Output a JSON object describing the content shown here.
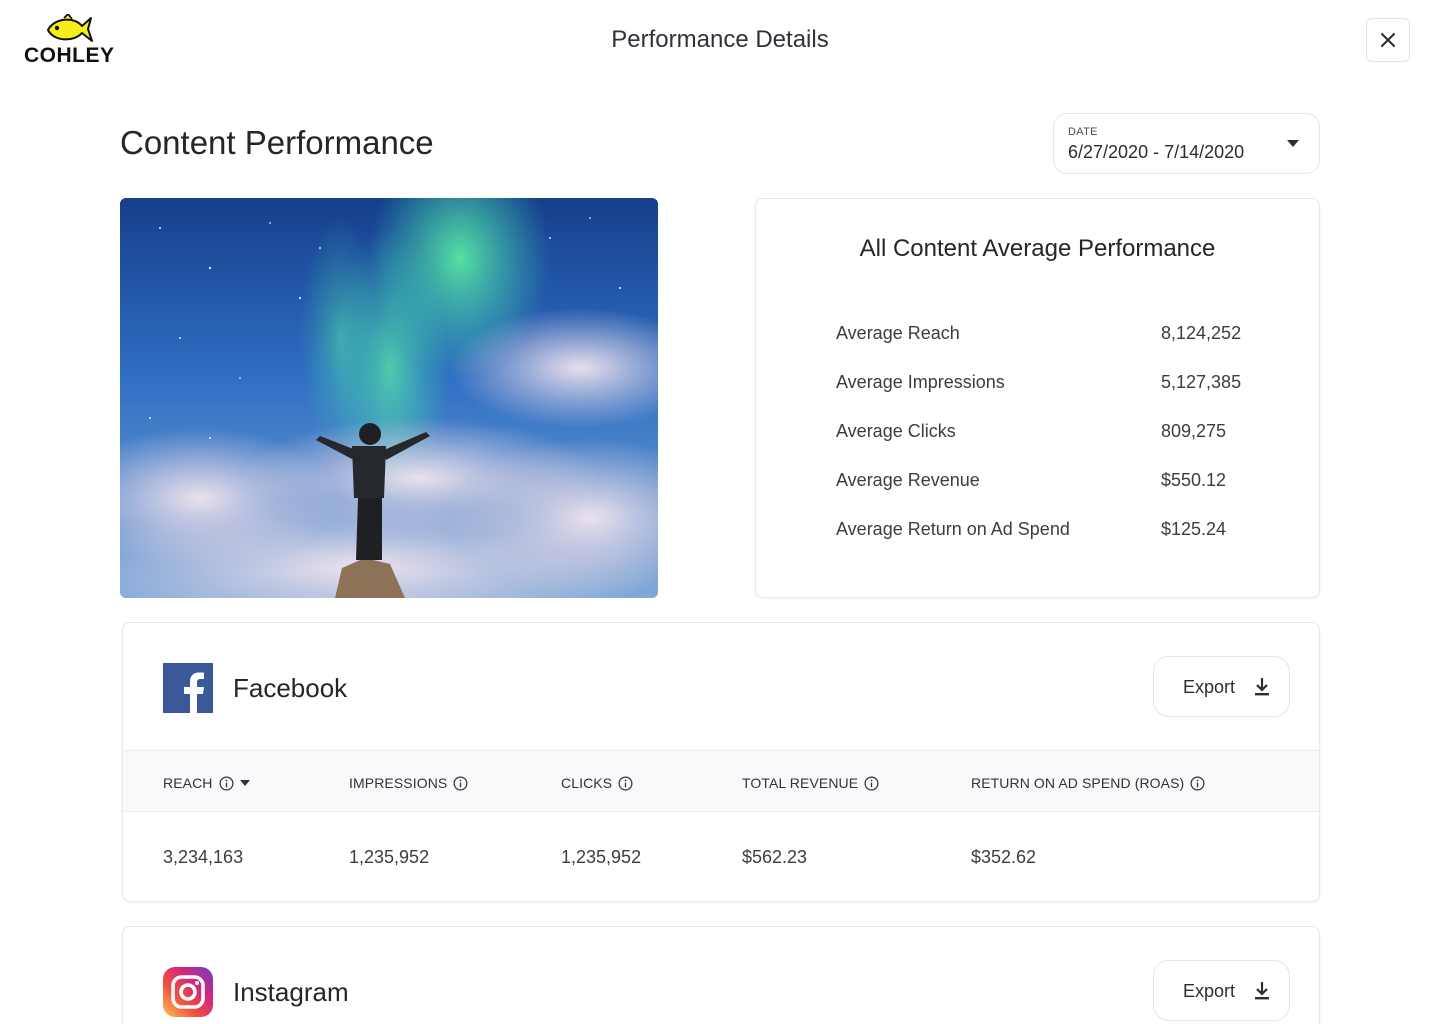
{
  "header": {
    "logo_text": "COHLEY",
    "title": "Performance Details",
    "close_icon": "close-icon"
  },
  "content": {
    "title": "Content Performance",
    "date": {
      "label": "DATE",
      "value": "6/27/2020 - 7/14/2020"
    },
    "hero_image": "person-under-aurora-sky-photo"
  },
  "averages": {
    "title": "All Content Average Performance",
    "rows": [
      {
        "label": "Average Reach",
        "value": "8,124,252"
      },
      {
        "label": "Average Impressions",
        "value": "5,127,385"
      },
      {
        "label": "Average Clicks",
        "value": "809,275"
      },
      {
        "label": "Average Revenue",
        "value": "$550.12"
      },
      {
        "label": "Average Return on Ad Spend",
        "value": "$125.24"
      }
    ]
  },
  "platforms": [
    {
      "name": "Facebook",
      "icon": "facebook-icon",
      "export_label": "Export",
      "columns": [
        "REACH",
        "IMPRESSIONS",
        "CLICKS",
        "TOTAL REVENUE",
        "RETURN ON AD SPEND (ROAS)"
      ],
      "values": [
        "3,234,163",
        "1,235,952",
        "1,235,952",
        "$562.23",
        "$352.62"
      ]
    },
    {
      "name": "Instagram",
      "icon": "instagram-icon",
      "export_label": "Export"
    }
  ],
  "colors": {
    "facebook": "#3b5998",
    "logo_fish": "#f7ec1c",
    "border": "#e6e8eb",
    "header_bg": "#f8f9fa"
  }
}
